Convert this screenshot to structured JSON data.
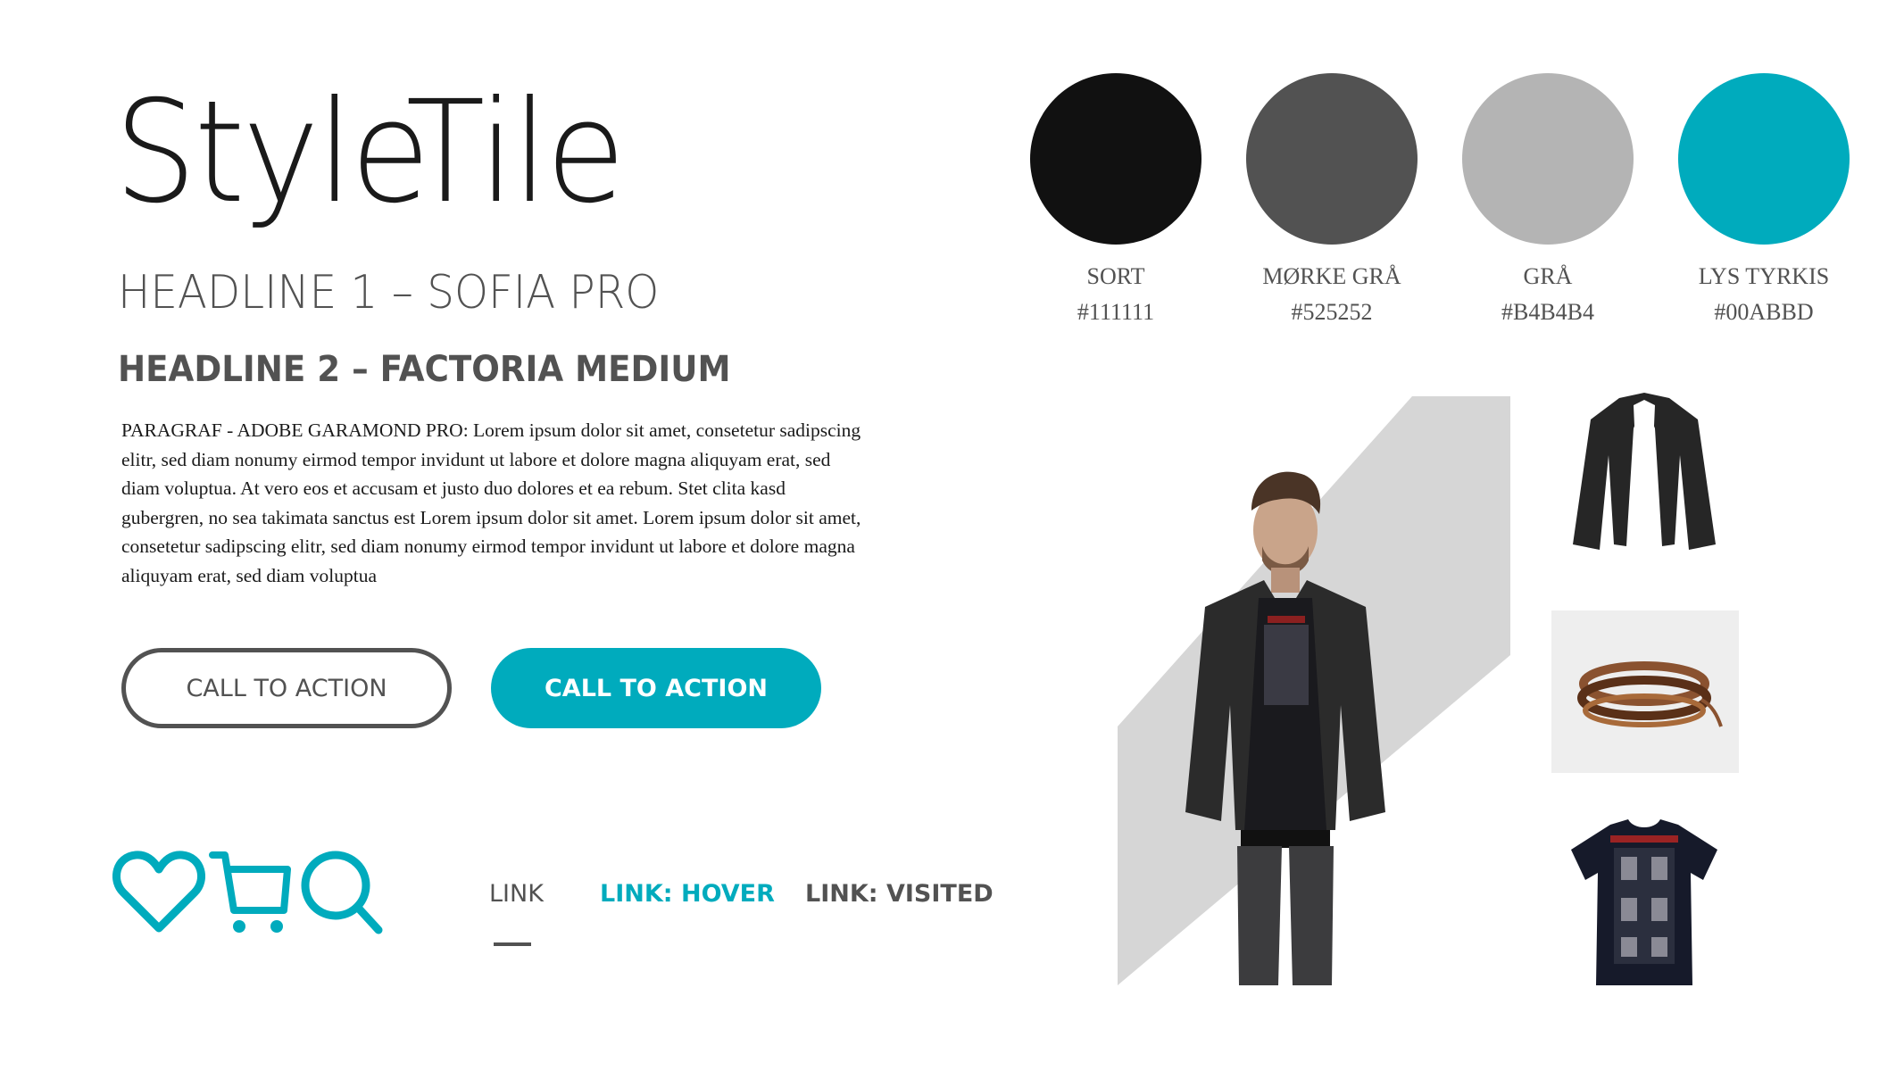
{
  "title": "StyleTile",
  "headline1": "HEADLINE 1 – SOFIA PRO",
  "headline2": "HEADLINE 2 – FACTORIA MEDIUM",
  "paragraph": "PARAGRAF - ADOBE GARAMOND PRO: Lorem ipsum dolor sit amet, consetetur sadipscing elitr, sed diam nonumy eirmod tempor invidunt ut labore et dolore magna aliquyam erat, sed diam voluptua. At vero eos et accusam et justo duo dolores et ea rebum. Stet clita kasd gubergren, no sea takimata sanctus est Lorem ipsum dolor sit amet. Lorem ipsum dolor sit amet, consetetur sadipscing elitr, sed diam nonumy eirmod tempor invidunt ut labore et dolore magna aliquyam erat, sed diam voluptua",
  "buttons": {
    "outline_label": "CALL TO ACTION",
    "filled_label": "CALL TO ACTION"
  },
  "icons": [
    "heart-icon",
    "cart-icon",
    "search-icon"
  ],
  "links": {
    "normal": "LINK",
    "hover": "LINK: HOVER",
    "visited": "LINK: VISITED"
  },
  "colors": [
    {
      "name": "SORT",
      "hex": "#111111"
    },
    {
      "name": "MØRKE GRÅ",
      "hex": "#525252"
    },
    {
      "name": "GRÅ",
      "hex": "#B4B4B4"
    },
    {
      "name": "LYS TYRKIS",
      "hex": "#00ABBD"
    }
  ],
  "images": [
    "model-photo",
    "blazer-photo",
    "bracelet-photo",
    "tshirt-photo"
  ]
}
